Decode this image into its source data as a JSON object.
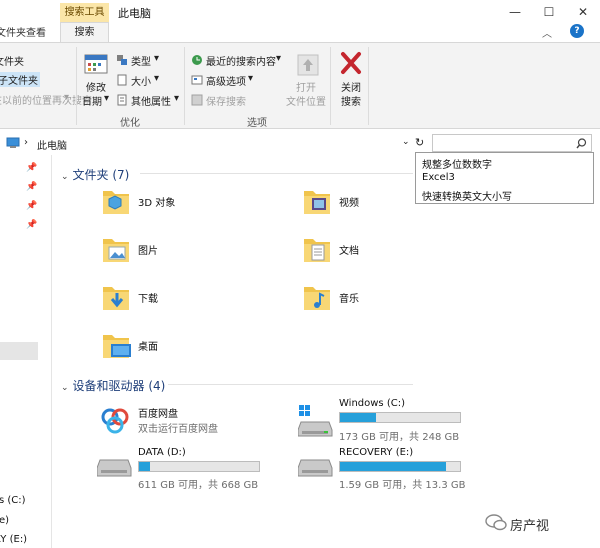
{
  "tabs": {
    "file_partial": "文件夹",
    "view": "查看",
    "search_tools_header": "搜索工具",
    "search": "搜索"
  },
  "window": {
    "title": "此电脑",
    "minimize": "—",
    "maximize": "☐",
    "close": "✕",
    "help": "?"
  },
  "ribbon": {
    "left_partial": {
      "current_folder": "文件夹",
      "subfolders": "子文件夹",
      "search_again": "在以前的位置再次搜索"
    },
    "refine": {
      "modify_date_line1": "修改",
      "modify_date_line2": "日期",
      "type": "类型",
      "size": "大小",
      "other_props": "其他属性",
      "group_label": "优化"
    },
    "options": {
      "recent": "最近的搜索内容",
      "advanced": "高级选项",
      "save": "保存搜索",
      "open_line1": "打开",
      "open_line2": "文件位置",
      "group_label": "选项"
    },
    "close": {
      "line1": "关闭",
      "line2": "搜索"
    }
  },
  "address": {
    "path": "此电脑"
  },
  "search_suggestions": [
    "规整多位数数字",
    "Excel3",
    "快速转换英文大小写"
  ],
  "nav": {
    "drives": [
      "s (C:)",
      "e)",
      "RY (E:)"
    ]
  },
  "folders": {
    "header": "文件夹 (7)",
    "items": [
      {
        "name": "3D 对象"
      },
      {
        "name": "视频"
      },
      {
        "name": "图片"
      },
      {
        "name": "文档"
      },
      {
        "name": "下载"
      },
      {
        "name": "音乐"
      },
      {
        "name": "桌面"
      }
    ]
  },
  "devices": {
    "header": "设备和驱动器 (4)",
    "items": [
      {
        "name": "百度网盘",
        "sub": "双击运行百度网盘"
      },
      {
        "name": "Windows (C:)",
        "sub": "173 GB 可用，共 248 GB",
        "fill_fraction": 0.3
      },
      {
        "name": "DATA (D:)",
        "sub": "611 GB 可用，共 668 GB",
        "fill_fraction": 0.09
      },
      {
        "name": "RECOVERY (E:)",
        "sub": "1.59 GB 可用，共 13.3 GB",
        "fill_fraction": 0.88
      }
    ]
  },
  "watermark": "房产视",
  "colors": {
    "accent": "#26a0da",
    "folder_yellow": "#f8d775",
    "ctx_tab": "#fbe6a8",
    "close_red": "#c4262e"
  }
}
